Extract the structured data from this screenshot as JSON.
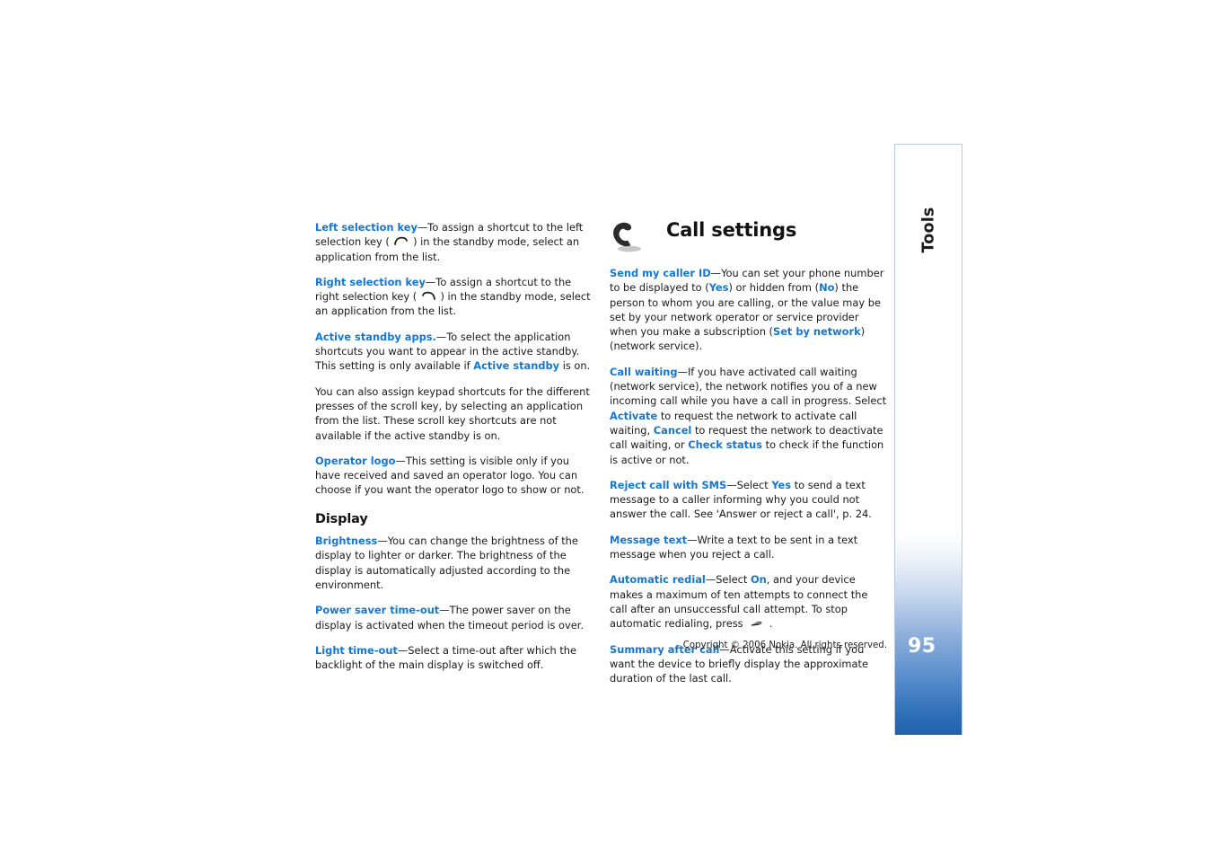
{
  "sidebar": {
    "chapter_label": "Tools",
    "page_number": "95",
    "accent_color": "#2d6cb5",
    "border_color": "#b6c9e6"
  },
  "colors": {
    "term_blue": "#1477d4",
    "body_text": "#1a1a1a"
  },
  "left_column": {
    "paragraphs": [
      {
        "term": "Left selection key",
        "dash": "—",
        "text_a": "To assign a shortcut to the left selection key ( ",
        "glyph": "left-selection-key-icon",
        "text_b": " ) in the standby mode, select an application from the list."
      },
      {
        "term": "Right selection key",
        "dash": "—",
        "text_a": "To assign a shortcut to the right selection key ( ",
        "glyph": "right-selection-key-icon",
        "text_b": " ) in the standby mode, select an application from the list."
      },
      {
        "term": "Active standby apps.",
        "dash": "—",
        "text_a": "To select the application shortcuts you want to appear in the active standby. This setting is only available if ",
        "inline_term": "Active standby",
        "text_b": " is on."
      },
      {
        "text": "You can also assign keypad shortcuts for the different presses of the scroll key, by selecting an application from the list. These scroll key shortcuts are not available if the active standby is on."
      },
      {
        "term": "Operator logo",
        "dash": "—",
        "text_a": "This setting is visible only if you have received and saved an operator logo. You can choose if you want the operator logo to show or not."
      }
    ],
    "display_heading": "Display",
    "display_paragraphs": [
      {
        "term": "Brightness",
        "dash": "—",
        "text_a": "You can change the brightness of the display to lighter or darker. The brightness of the display is automatically adjusted according to the environment."
      },
      {
        "term": "Power saver time-out",
        "dash": "—",
        "text_a": "The power saver on the display is activated when the timeout period is over."
      },
      {
        "term": "Light time-out",
        "dash": "—",
        "text_a": "Select a time-out after which the backlight of the main display is switched off."
      }
    ]
  },
  "right_column": {
    "chapter_title": "Call settings",
    "chapter_icon": "phone-handset-icon",
    "paragraphs": {
      "send_caller_id": {
        "term": "Send my caller ID",
        "dash": "—",
        "t1": "You can set your phone number to be displayed to (",
        "v1": "Yes",
        "t2": ") or hidden from (",
        "v2": "No",
        "t3": ") the person to whom you are calling, or the value may be set by your network operator or service provider when you make a subscription (",
        "v3": "Set by network",
        "t4": ") (network service)."
      },
      "call_waiting": {
        "term": "Call waiting",
        "dash": "—",
        "t1": "If you have activated call waiting (network service), the network notifies you of a new incoming call while you have a call in progress. Select ",
        "v1": "Activate",
        "t2": " to request the network to activate call waiting, ",
        "v2": "Cancel",
        "t3": " to request the network to deactivate call waiting, or ",
        "v3": "Check status",
        "t4": " to check if the function is active or not."
      },
      "reject_call_sms": {
        "term": "Reject call with SMS",
        "dash": "—",
        "t1": "Select ",
        "v1": "Yes",
        "t2": " to send a text message to a caller informing why you could not answer the call. See 'Answer or reject a call', p. 24."
      },
      "message_text": {
        "term": "Message text",
        "dash": "—",
        "t1": "Write a text to be sent in a text message when you reject a call."
      },
      "automatic_redial": {
        "term": "Automatic redial",
        "dash": "—",
        "t1": "Select ",
        "v1": "On",
        "t2": ", and your device makes a maximum of ten attempts to connect the call after an unsuccessful call attempt. To stop automatic redialing, press ",
        "glyph": "end-call-key-icon",
        "t3": " ."
      },
      "summary_after_call": {
        "term": "Summary after call",
        "dash": "—",
        "t1": "Activate this setting if you want the device to briefly display the approximate duration of the last call."
      }
    }
  },
  "footer": {
    "copyright": "Copyright © 2006 Nokia. All rights reserved."
  }
}
